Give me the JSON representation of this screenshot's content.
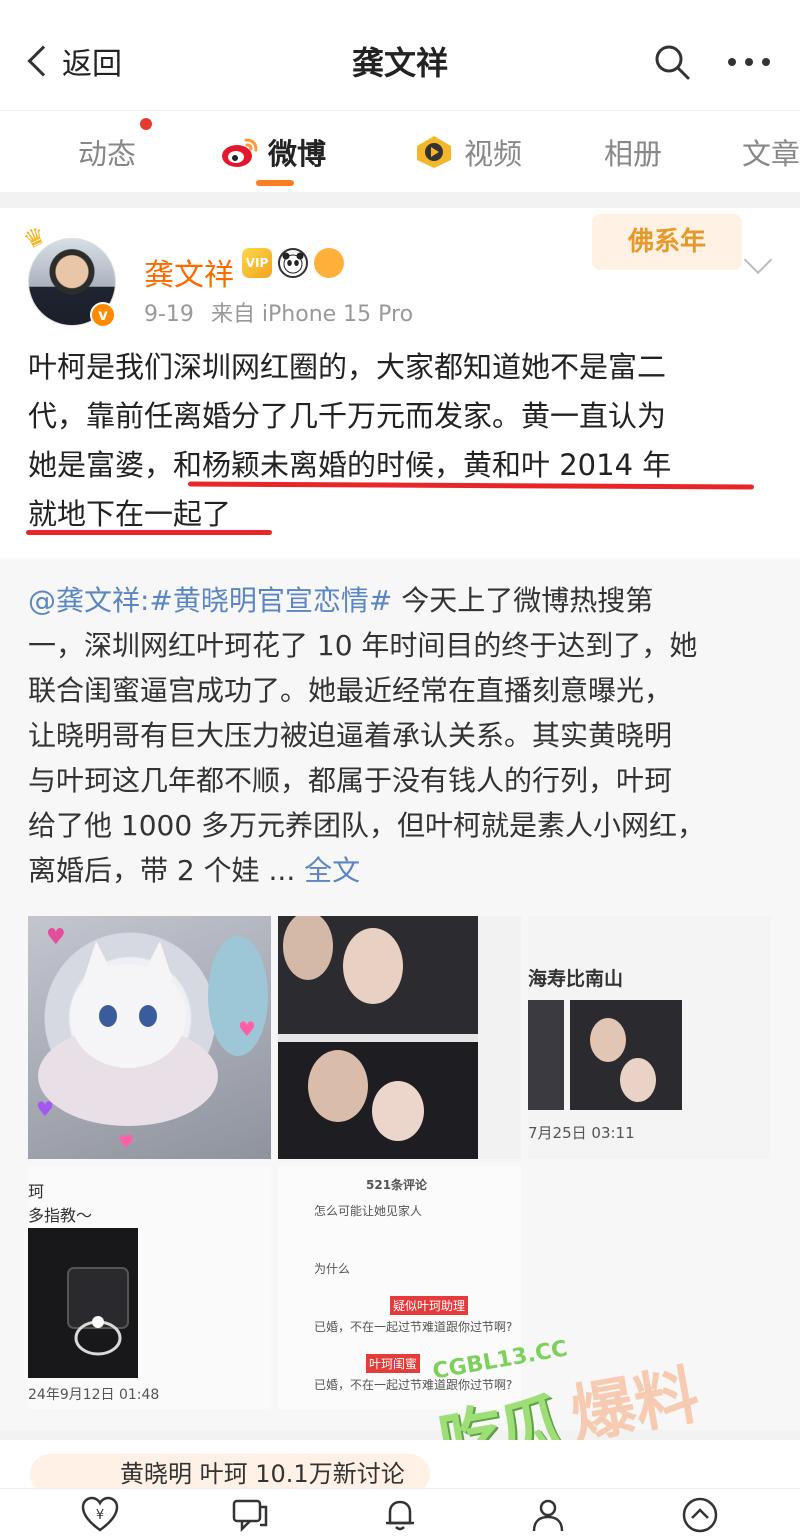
{
  "navbar": {
    "back_label": "返回",
    "title": "龚文祥"
  },
  "tabs": [
    {
      "label": "动态"
    },
    {
      "label": "微博"
    },
    {
      "label": "视频"
    },
    {
      "label": "相册"
    },
    {
      "label": "文章"
    }
  ],
  "post": {
    "author": "龚文祥",
    "badge_vip": "VIP",
    "date": "9-19",
    "source": "来自 iPhone 15 Pro",
    "sticker_text": "佛系年",
    "text_line1": "叶柯是我们深圳网红圈的，大家都知道她不是富二",
    "text_line2": "代，靠前任离婚分了几千万元而发家。黄一直认为",
    "text_line3": "她是富婆，和杨颖未离婚的时候，黄和叶 2014 年",
    "text_line4": "就地下在一起了"
  },
  "repost": {
    "mention": "@龚文祥:#黄晓明官宣恋情#",
    "line1_rest": " 今天上了微博热搜第",
    "line2": "一，深圳网红叶珂花了 10 年时间目的终于达到了，她",
    "line3": "联合闺蜜逼宫成功了。她最近经常在直播刻意曝光，",
    "line4": "让晓明哥有巨大压力被迫逼着承认关系。其实黄晓明",
    "line5": "与叶珂这几年都不顺，都属于没有钱人的行列，叶珂",
    "line6": "给了他 1000 多万元养团队，但叶柯就是素人小网红，",
    "line7_text": "离婚后，带 2 个娃 ... ",
    "full_text": "全文"
  },
  "images": {
    "img3_caption": "海寿比南山",
    "img3_date": "7月25日 03:11",
    "img4_caption1": "珂",
    "img4_caption2": "多指教～",
    "img4_date": "24年9月12日 01:48",
    "img5_title": "521条评论",
    "img5_c1": "怎么可能让她见家人",
    "img5_c2": "为什么",
    "img5_tag1": "疑似叶珂助理",
    "img5_c3": "已婚，不在一起过节难道跟你过节啊?",
    "img5_tag2": "叶珂闺蜜",
    "img5_c4": "已婚，不在一起过节难道跟你过节啊?"
  },
  "watermark": {
    "url": "CGBL13.CC",
    "text_green": "吃瓜",
    "text_orange": "爆料"
  },
  "next_card": {
    "text": "黄晓明 叶珂 10.1万新讨论"
  },
  "colors": {
    "accent_orange": "#ff7c20",
    "username_orange": "#ff6a00",
    "link_blue": "#5b86c2",
    "underline_red": "#e8262a"
  }
}
